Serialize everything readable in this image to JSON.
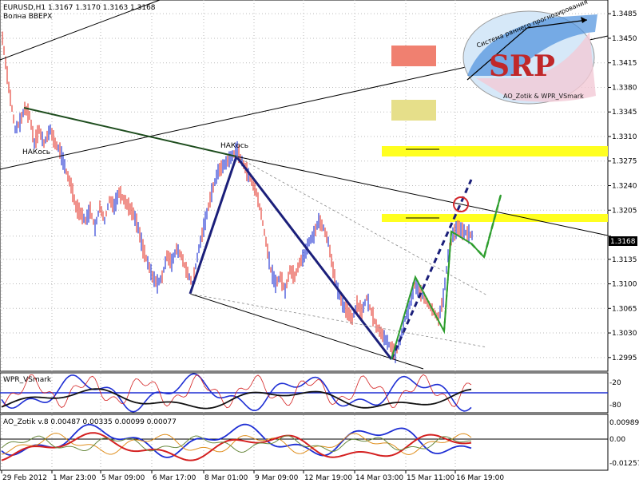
{
  "window": {
    "symbol_line": "EURUSD,H1  1.3167 1.3170 1.3163 1.3168",
    "subtitle": "Волна ВВЕРХ"
  },
  "logo": {
    "arc_text": "Система раннего прогнозирования",
    "big": "SRP",
    "bottom": "AO_Zotik & WPR_VSmark"
  },
  "labels": {
    "nak1": "НАКось",
    "nak2": "НАКось"
  },
  "colors": {
    "bull": "#3d4fd9",
    "bear": "#e8574f",
    "trendline": "#1a1a1a",
    "thick_blue": "#1b1f7a",
    "dark_green": "#1e4d1e",
    "green": "#2e9e2e",
    "yellow": "#ffff20",
    "salmon": "#f08070",
    "khaki": "#e6df8a",
    "red_circle": "#d4282d"
  },
  "chart_data": {
    "type": "line",
    "instrument": "EURUSD",
    "timeframe": "H1",
    "ohlc_last": {
      "open": 1.3167,
      "high": 1.317,
      "low": 1.3163,
      "close": 1.3168
    },
    "current_price": "1.3168",
    "y_ticks": [
      "1.3485",
      "1.3450",
      "1.3415",
      "1.3380",
      "1.3345",
      "1.3310",
      "1.3275",
      "1.3240",
      "1.3205",
      "1.3168",
      "1.3135",
      "1.3100",
      "1.3065",
      "1.3030",
      "1.2995"
    ],
    "x_ticks": [
      "29 Feb 2012",
      "1 Mar 23:00",
      "5 Mar 09:00",
      "6 Mar 17:00",
      "8 Mar 01:00",
      "9 Mar 09:00",
      "12 Mar 19:00",
      "14 Mar 03:00",
      "15 Mar 11:00",
      "16 Mar 19:00"
    ],
    "price_path": [
      [
        0,
        1.345
      ],
      [
        8,
        1.338
      ],
      [
        16,
        1.332
      ],
      [
        22,
        1.333
      ],
      [
        28,
        1.335
      ],
      [
        34,
        1.334
      ],
      [
        40,
        1.33
      ],
      [
        46,
        1.332
      ],
      [
        52,
        1.33
      ],
      [
        60,
        1.332
      ],
      [
        66,
        1.33
      ],
      [
        72,
        1.329
      ],
      [
        80,
        1.326
      ],
      [
        86,
        1.324
      ],
      [
        92,
        1.321
      ],
      [
        98,
        1.32
      ],
      [
        104,
        1.319
      ],
      [
        110,
        1.3205
      ],
      [
        116,
        1.318
      ],
      [
        122,
        1.321
      ],
      [
        128,
        1.319
      ],
      [
        134,
        1.322
      ],
      [
        140,
        1.321
      ],
      [
        146,
        1.323
      ],
      [
        152,
        1.322
      ],
      [
        158,
        1.321
      ],
      [
        164,
        1.32
      ],
      [
        170,
        1.318
      ],
      [
        176,
        1.315
      ],
      [
        182,
        1.313
      ],
      [
        188,
        1.311
      ],
      [
        194,
        1.31
      ],
      [
        200,
        1.311
      ],
      [
        206,
        1.314
      ],
      [
        212,
        1.313
      ],
      [
        218,
        1.315
      ],
      [
        224,
        1.314
      ],
      [
        230,
        1.312
      ],
      [
        238,
        1.31
      ],
      [
        246,
        1.315
      ],
      [
        254,
        1.319
      ],
      [
        262,
        1.323
      ],
      [
        270,
        1.326
      ],
      [
        278,
        1.327
      ],
      [
        286,
        1.328
      ],
      [
        294,
        1.329
      ],
      [
        302,
        1.327
      ],
      [
        310,
        1.325
      ],
      [
        318,
        1.323
      ],
      [
        324,
        1.32
      ],
      [
        330,
        1.316
      ],
      [
        336,
        1.312
      ],
      [
        342,
        1.31
      ],
      [
        348,
        1.311
      ],
      [
        354,
        1.309
      ],
      [
        360,
        1.312
      ],
      [
        366,
        1.311
      ],
      [
        372,
        1.313
      ],
      [
        378,
        1.314
      ],
      [
        384,
        1.316
      ],
      [
        390,
        1.317
      ],
      [
        396,
        1.319
      ],
      [
        402,
        1.318
      ],
      [
        408,
        1.316
      ],
      [
        414,
        1.312
      ],
      [
        420,
        1.309
      ],
      [
        426,
        1.307
      ],
      [
        432,
        1.306
      ],
      [
        438,
        1.305
      ],
      [
        444,
        1.307
      ],
      [
        450,
        1.306
      ],
      [
        456,
        1.308
      ],
      [
        462,
        1.306
      ],
      [
        468,
        1.304
      ],
      [
        474,
        1.303
      ],
      [
        480,
        1.302
      ],
      [
        486,
        1.301
      ],
      [
        492,
        1.3
      ],
      [
        498,
        1.302
      ],
      [
        504,
        1.305
      ],
      [
        510,
        1.307
      ],
      [
        516,
        1.31
      ],
      [
        522,
        1.309
      ],
      [
        528,
        1.308
      ],
      [
        534,
        1.307
      ],
      [
        540,
        1.306
      ],
      [
        546,
        1.305
      ],
      [
        552,
        1.308
      ],
      [
        558,
        1.314
      ],
      [
        564,
        1.317
      ],
      [
        570,
        1.318
      ],
      [
        576,
        1.3175
      ],
      [
        582,
        1.3172
      ],
      [
        590,
        1.3168
      ]
    ],
    "panels": [
      {
        "name": "WPR_VSmark",
        "levels": [
          "-20",
          "-80"
        ]
      },
      {
        "name": "AO_Zotik v.8 0.00487 0.00335 0.00099 0.00077",
        "levels": [
          "0.00989",
          "0.00",
          "-0.01257"
        ]
      }
    ]
  }
}
